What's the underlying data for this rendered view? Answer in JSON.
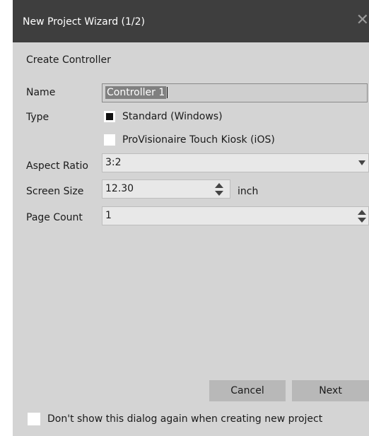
{
  "window": {
    "title": "New Project Wizard (1/2)",
    "close_glyph": "✕",
    "close_icon": "close-icon"
  },
  "section_title": "Create Controller",
  "fields": {
    "name_label": "Name",
    "name_value": "Controller 1",
    "type_label": "Type",
    "type_options": [
      {
        "label": "Standard (Windows)",
        "checked": true
      },
      {
        "label": "ProVisionaire Touch Kiosk (iOS)",
        "checked": false
      }
    ],
    "aspect_label": "Aspect Ratio",
    "aspect_value": "3:2",
    "screen_label": "Screen Size",
    "screen_value": "12.30",
    "screen_unit": "inch",
    "page_label": "Page Count",
    "page_value": "1"
  },
  "buttons": {
    "cancel": "Cancel",
    "next": "Next"
  },
  "footer": {
    "checkbox_label": "Don't show this dialog again when creating new project",
    "checked": false
  },
  "colors": {
    "titlebar": "#3e3e3e",
    "dialog_bg": "#d4d4d4",
    "button_bg": "#b8b8b8"
  }
}
